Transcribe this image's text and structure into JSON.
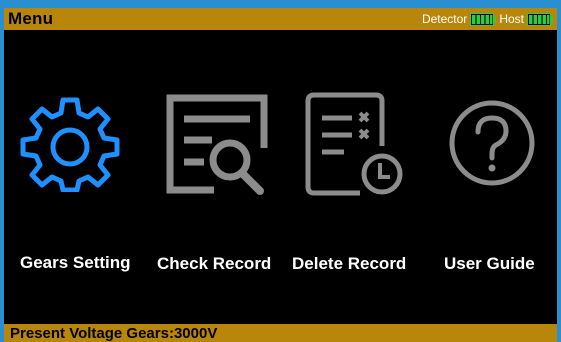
{
  "header": {
    "title": "Menu",
    "detector_label": "Detector",
    "host_label": "Host"
  },
  "menu": {
    "items": [
      {
        "label": "Gears  Setting",
        "icon": "gear-icon"
      },
      {
        "label": "Check Record",
        "icon": "check-record-icon"
      },
      {
        "label": "Delete  Record",
        "icon": "delete-record-icon"
      },
      {
        "label": "User  Guide",
        "icon": "help-icon"
      }
    ]
  },
  "footer": {
    "status": "Present Voltage Gears:3000V"
  },
  "colors": {
    "accent": "#b8860b",
    "selected_icon": "#1e90ff",
    "icon_gray": "#8c8c8c",
    "battery_green": "#2ecc40"
  }
}
